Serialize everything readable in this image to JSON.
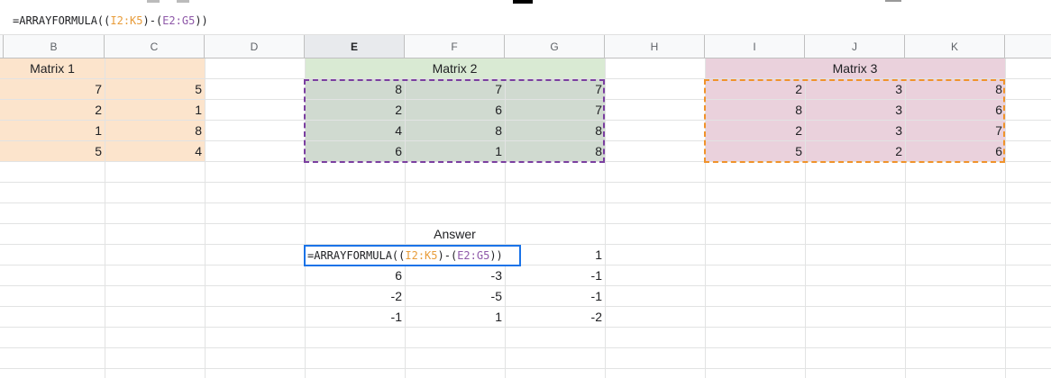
{
  "formula_bar": {
    "prefix": "=ARRAYFORMULA((",
    "ref1": "I2:K5",
    "middle": ")-(",
    "ref2": "E2:G5",
    "suffix": "))"
  },
  "columns": [
    "B",
    "C",
    "D",
    "E",
    "F",
    "G",
    "H",
    "I",
    "J",
    "K"
  ],
  "colors": {
    "matrix1_fill": "#fce4cc",
    "matrix2_fill": "#d9ead3",
    "matrix2_data_fill": "#d0dad0",
    "matrix3_fill": "#ead1dc",
    "ref1_color": "#f0932b",
    "ref2_color": "#7b3fa0",
    "editor_border": "#1a73e8"
  },
  "matrix1": {
    "title": "Matrix 1",
    "rows": [
      [
        "7",
        "5"
      ],
      [
        "2",
        "1"
      ],
      [
        "1",
        "8"
      ],
      [
        "5",
        "4"
      ]
    ]
  },
  "matrix2": {
    "title": "Matrix 2",
    "rows": [
      [
        "8",
        "7",
        "7"
      ],
      [
        "2",
        "6",
        "7"
      ],
      [
        "4",
        "8",
        "8"
      ],
      [
        "6",
        "1",
        "8"
      ]
    ]
  },
  "matrix3": {
    "title": "Matrix 3",
    "rows": [
      [
        "2",
        "3",
        "8"
      ],
      [
        "8",
        "3",
        "6"
      ],
      [
        "2",
        "3",
        "7"
      ],
      [
        "5",
        "2",
        "6"
      ]
    ]
  },
  "answer": {
    "title": "Answer",
    "first_row_g": "1",
    "rows": [
      [
        "6",
        "-3",
        "-1"
      ],
      [
        "-2",
        "-5",
        "-1"
      ],
      [
        "-1",
        "1",
        "-2"
      ]
    ]
  }
}
